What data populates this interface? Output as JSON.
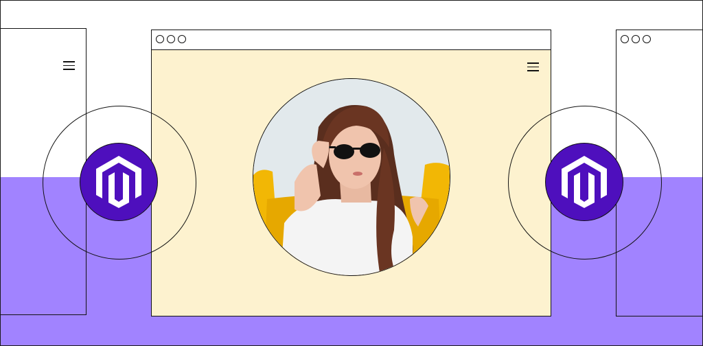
{
  "scene": {
    "background_top_color": "#ffffff",
    "background_bottom_color": "#a183ff",
    "content_panel_color": "#fdf2cf",
    "logo_badge_color": "#4e0fbd"
  },
  "windows": {
    "left": {
      "menu_icon": "hamburger-menu-icon"
    },
    "center": {
      "controls_icon": "window-dots-icon",
      "menu_icon": "hamburger-menu-icon"
    },
    "right": {
      "controls_icon": "window-dots-icon"
    }
  },
  "logos": [
    {
      "icon": "magento-logo-icon"
    },
    {
      "icon": "magento-logo-icon"
    }
  ],
  "hero_image": {
    "subject": "woman-with-sunglasses-photo"
  }
}
